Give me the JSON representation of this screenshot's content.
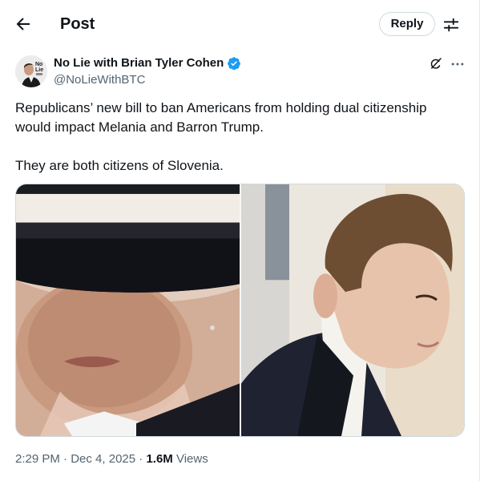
{
  "header": {
    "title": "Post",
    "reply_label": "Reply"
  },
  "icons": {
    "back": "arrow-left-icon",
    "settings": "sliders-icon",
    "verified": "verified-badge-icon",
    "grok": "grok-icon",
    "more": "more-dots-icon"
  },
  "author": {
    "name": "No Lie with Brian Tyler Cohen",
    "handle": "@NoLieWithBTC",
    "avatar_text": "No Lie"
  },
  "tweet": {
    "line1": "Republicans’ new bill to ban Americans from holding dual citizenship would impact Melania and Barron Trump.",
    "line2": "They are both citizens of Slovenia."
  },
  "meta": {
    "time": "2:29 PM",
    "sep1": " · ",
    "date": "Dec 4, 2025",
    "sep2": " · ",
    "views_count": "1.6M",
    "views_label": " Views"
  },
  "colors": {
    "text": "#0f1419",
    "secondary": "#536471",
    "verified": "#1d9bf0",
    "border": "#cfd9de"
  }
}
